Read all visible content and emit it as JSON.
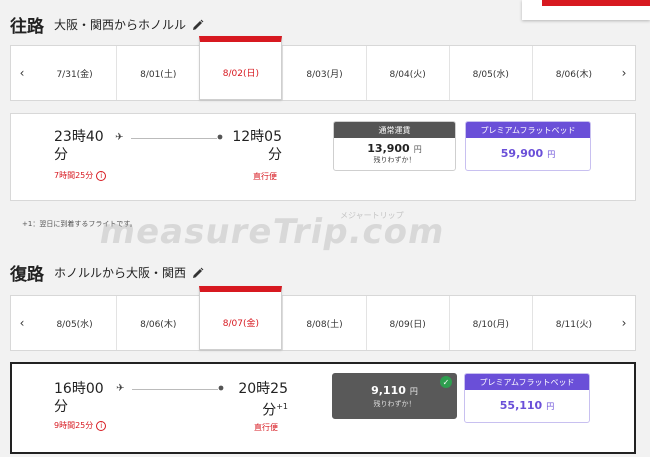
{
  "outbound": {
    "title": "往路",
    "route": "大阪・関西からホノルル",
    "dates": [
      "7/31(金)",
      "8/01(土)",
      "8/02(日)",
      "8/03(月)",
      "8/04(火)",
      "8/05(水)",
      "8/06(木)"
    ],
    "selected_index": 2,
    "flight": {
      "depart_time_line1": "23時40",
      "depart_time_line2": "分",
      "arrive_time_line1": "12時05",
      "arrive_time_line2": "分",
      "duration": "7時間25分",
      "direct": "直行便"
    },
    "fares": {
      "normal": {
        "label": "通常運賃",
        "price": "13,900",
        "yen": "円",
        "few": "残りわずか！"
      },
      "premium": {
        "label": "プレミアムフラットベッド",
        "price": "59,900",
        "yen": "円"
      }
    }
  },
  "note": "+1：翌日に到着するフライトです。",
  "watermark": {
    "main": "measureTrip.com",
    "sub": "メジャートリップ"
  },
  "return": {
    "title": "復路",
    "route": "ホノルルから大阪・関西",
    "dates": [
      "8/05(水)",
      "8/06(木)",
      "8/07(金)",
      "8/08(土)",
      "8/09(日)",
      "8/10(月)",
      "8/11(火)"
    ],
    "selected_index": 2,
    "flight": {
      "depart_time_line1": "16時00",
      "depart_time_line2": "分",
      "arrive_time_line1": "20時25",
      "arrive_time_line2": "分",
      "plus_one": "+1",
      "duration": "9時間25分",
      "direct": "直行便"
    },
    "fares": {
      "normal": {
        "price": "9,110",
        "yen": "円",
        "few": "残りわずか！"
      },
      "premium": {
        "label": "プレミアムフラットベッド",
        "price": "55,110",
        "yen": "円"
      }
    }
  },
  "icons": {
    "prev": "‹",
    "next": "›",
    "plane": "✈",
    "check": "✓",
    "info": "i"
  },
  "colors": {
    "accent": "#d71920",
    "premium": "#6a4fd8",
    "selected_fare": "#595959",
    "check": "#2e9e4f"
  }
}
